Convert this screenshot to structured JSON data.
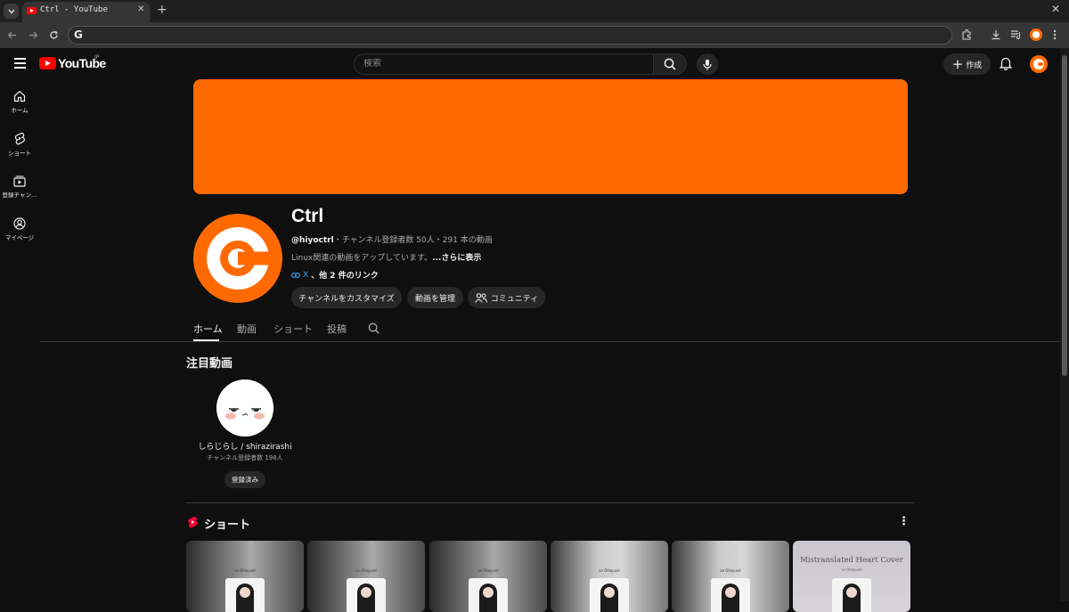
{
  "browser": {
    "tab_title": "Ctrl - YouTube",
    "tab_close": "✕",
    "new_tab": "+",
    "window_close": "✕",
    "omnibox_icon": "G",
    "omnibox_url": ""
  },
  "masthead": {
    "logo_text": "YouTube",
    "logo_region": "JP",
    "search_placeholder": "検索",
    "create_label": "作成",
    "create_plus": "+"
  },
  "guide": [
    {
      "label": "ホーム",
      "icon": "home-icon"
    },
    {
      "label": "ショート",
      "icon": "shorts-icon"
    },
    {
      "label": "登録チャン…",
      "icon": "subscriptions-icon"
    },
    {
      "label": "マイページ",
      "icon": "account-icon"
    }
  ],
  "channel": {
    "name": "Ctrl",
    "handle": "@hiyoctrl",
    "stats": "・チャンネル登録者数 50人・291 本の動画",
    "description": "Linux関連の動画をアップしています。",
    "more": "...さらに表示",
    "link_x": "X",
    "more_links": "、他 2 件のリンク",
    "buttons": {
      "customize": "チャンネルをカスタマイズ",
      "manage": "動画を管理",
      "community": "コミュニティ"
    },
    "banner_color": "#ff6a00"
  },
  "tabs": [
    {
      "label": "ホーム",
      "active": true
    },
    {
      "label": "動画",
      "active": false
    },
    {
      "label": "ショート",
      "active": false
    },
    {
      "label": "投稿",
      "active": false
    }
  ],
  "featured": {
    "title": "注目動画",
    "channel_name": "しらじらし / shirazirashi",
    "subscribers": "チャンネル登録者数 198人",
    "subscribe_state": "登録済み"
  },
  "shorts": {
    "title": "ショート",
    "menu": "⋮",
    "cards": [
      {
        "mini_title": "Le Ollayuiel"
      },
      {
        "mini_title": "Le Ollayuiel"
      },
      {
        "mini_title": "Le Ollayuiel"
      },
      {
        "mini_title": "Le Ollayuiel"
      },
      {
        "mini_title": "Le Ollayuiel"
      },
      {
        "cover_title": "Mistranslated Heart Cover",
        "cover_sub": "Le Ollayuiel"
      }
    ]
  },
  "colors": {
    "background": "#0f0f0f",
    "accent": "#ff6a00",
    "youtube_red": "#ff0000",
    "link_blue": "#3ea6ff"
  }
}
